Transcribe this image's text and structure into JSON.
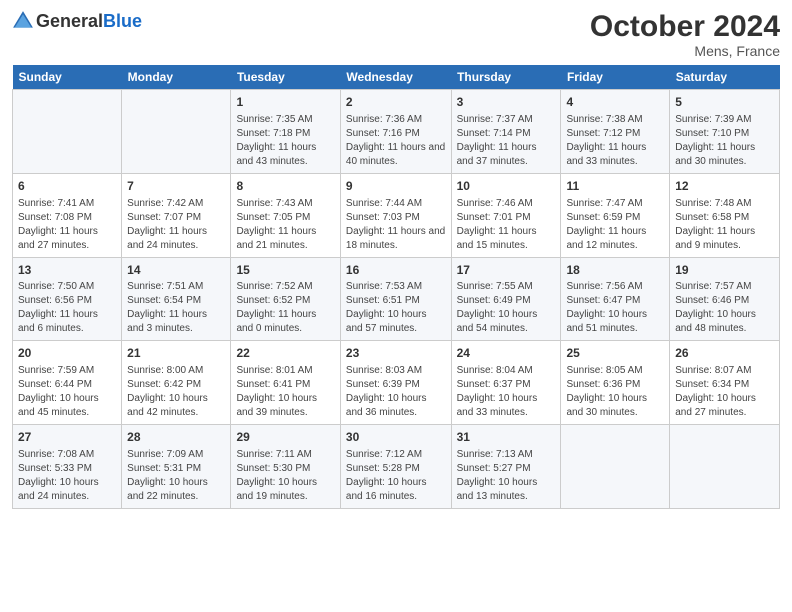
{
  "header": {
    "logo_general": "General",
    "logo_blue": "Blue",
    "title": "October 2024",
    "subtitle": "Mens, France"
  },
  "days_of_week": [
    "Sunday",
    "Monday",
    "Tuesday",
    "Wednesday",
    "Thursday",
    "Friday",
    "Saturday"
  ],
  "weeks": [
    [
      {
        "day": "",
        "info": ""
      },
      {
        "day": "",
        "info": ""
      },
      {
        "day": "1",
        "info": "Sunrise: 7:35 AM\nSunset: 7:18 PM\nDaylight: 11 hours and 43 minutes."
      },
      {
        "day": "2",
        "info": "Sunrise: 7:36 AM\nSunset: 7:16 PM\nDaylight: 11 hours and 40 minutes."
      },
      {
        "day": "3",
        "info": "Sunrise: 7:37 AM\nSunset: 7:14 PM\nDaylight: 11 hours and 37 minutes."
      },
      {
        "day": "4",
        "info": "Sunrise: 7:38 AM\nSunset: 7:12 PM\nDaylight: 11 hours and 33 minutes."
      },
      {
        "day": "5",
        "info": "Sunrise: 7:39 AM\nSunset: 7:10 PM\nDaylight: 11 hours and 30 minutes."
      }
    ],
    [
      {
        "day": "6",
        "info": "Sunrise: 7:41 AM\nSunset: 7:08 PM\nDaylight: 11 hours and 27 minutes."
      },
      {
        "day": "7",
        "info": "Sunrise: 7:42 AM\nSunset: 7:07 PM\nDaylight: 11 hours and 24 minutes."
      },
      {
        "day": "8",
        "info": "Sunrise: 7:43 AM\nSunset: 7:05 PM\nDaylight: 11 hours and 21 minutes."
      },
      {
        "day": "9",
        "info": "Sunrise: 7:44 AM\nSunset: 7:03 PM\nDaylight: 11 hours and 18 minutes."
      },
      {
        "day": "10",
        "info": "Sunrise: 7:46 AM\nSunset: 7:01 PM\nDaylight: 11 hours and 15 minutes."
      },
      {
        "day": "11",
        "info": "Sunrise: 7:47 AM\nSunset: 6:59 PM\nDaylight: 11 hours and 12 minutes."
      },
      {
        "day": "12",
        "info": "Sunrise: 7:48 AM\nSunset: 6:58 PM\nDaylight: 11 hours and 9 minutes."
      }
    ],
    [
      {
        "day": "13",
        "info": "Sunrise: 7:50 AM\nSunset: 6:56 PM\nDaylight: 11 hours and 6 minutes."
      },
      {
        "day": "14",
        "info": "Sunrise: 7:51 AM\nSunset: 6:54 PM\nDaylight: 11 hours and 3 minutes."
      },
      {
        "day": "15",
        "info": "Sunrise: 7:52 AM\nSunset: 6:52 PM\nDaylight: 11 hours and 0 minutes."
      },
      {
        "day": "16",
        "info": "Sunrise: 7:53 AM\nSunset: 6:51 PM\nDaylight: 10 hours and 57 minutes."
      },
      {
        "day": "17",
        "info": "Sunrise: 7:55 AM\nSunset: 6:49 PM\nDaylight: 10 hours and 54 minutes."
      },
      {
        "day": "18",
        "info": "Sunrise: 7:56 AM\nSunset: 6:47 PM\nDaylight: 10 hours and 51 minutes."
      },
      {
        "day": "19",
        "info": "Sunrise: 7:57 AM\nSunset: 6:46 PM\nDaylight: 10 hours and 48 minutes."
      }
    ],
    [
      {
        "day": "20",
        "info": "Sunrise: 7:59 AM\nSunset: 6:44 PM\nDaylight: 10 hours and 45 minutes."
      },
      {
        "day": "21",
        "info": "Sunrise: 8:00 AM\nSunset: 6:42 PM\nDaylight: 10 hours and 42 minutes."
      },
      {
        "day": "22",
        "info": "Sunrise: 8:01 AM\nSunset: 6:41 PM\nDaylight: 10 hours and 39 minutes."
      },
      {
        "day": "23",
        "info": "Sunrise: 8:03 AM\nSunset: 6:39 PM\nDaylight: 10 hours and 36 minutes."
      },
      {
        "day": "24",
        "info": "Sunrise: 8:04 AM\nSunset: 6:37 PM\nDaylight: 10 hours and 33 minutes."
      },
      {
        "day": "25",
        "info": "Sunrise: 8:05 AM\nSunset: 6:36 PM\nDaylight: 10 hours and 30 minutes."
      },
      {
        "day": "26",
        "info": "Sunrise: 8:07 AM\nSunset: 6:34 PM\nDaylight: 10 hours and 27 minutes."
      }
    ],
    [
      {
        "day": "27",
        "info": "Sunrise: 7:08 AM\nSunset: 5:33 PM\nDaylight: 10 hours and 24 minutes."
      },
      {
        "day": "28",
        "info": "Sunrise: 7:09 AM\nSunset: 5:31 PM\nDaylight: 10 hours and 22 minutes."
      },
      {
        "day": "29",
        "info": "Sunrise: 7:11 AM\nSunset: 5:30 PM\nDaylight: 10 hours and 19 minutes."
      },
      {
        "day": "30",
        "info": "Sunrise: 7:12 AM\nSunset: 5:28 PM\nDaylight: 10 hours and 16 minutes."
      },
      {
        "day": "31",
        "info": "Sunrise: 7:13 AM\nSunset: 5:27 PM\nDaylight: 10 hours and 13 minutes."
      },
      {
        "day": "",
        "info": ""
      },
      {
        "day": "",
        "info": ""
      }
    ]
  ]
}
